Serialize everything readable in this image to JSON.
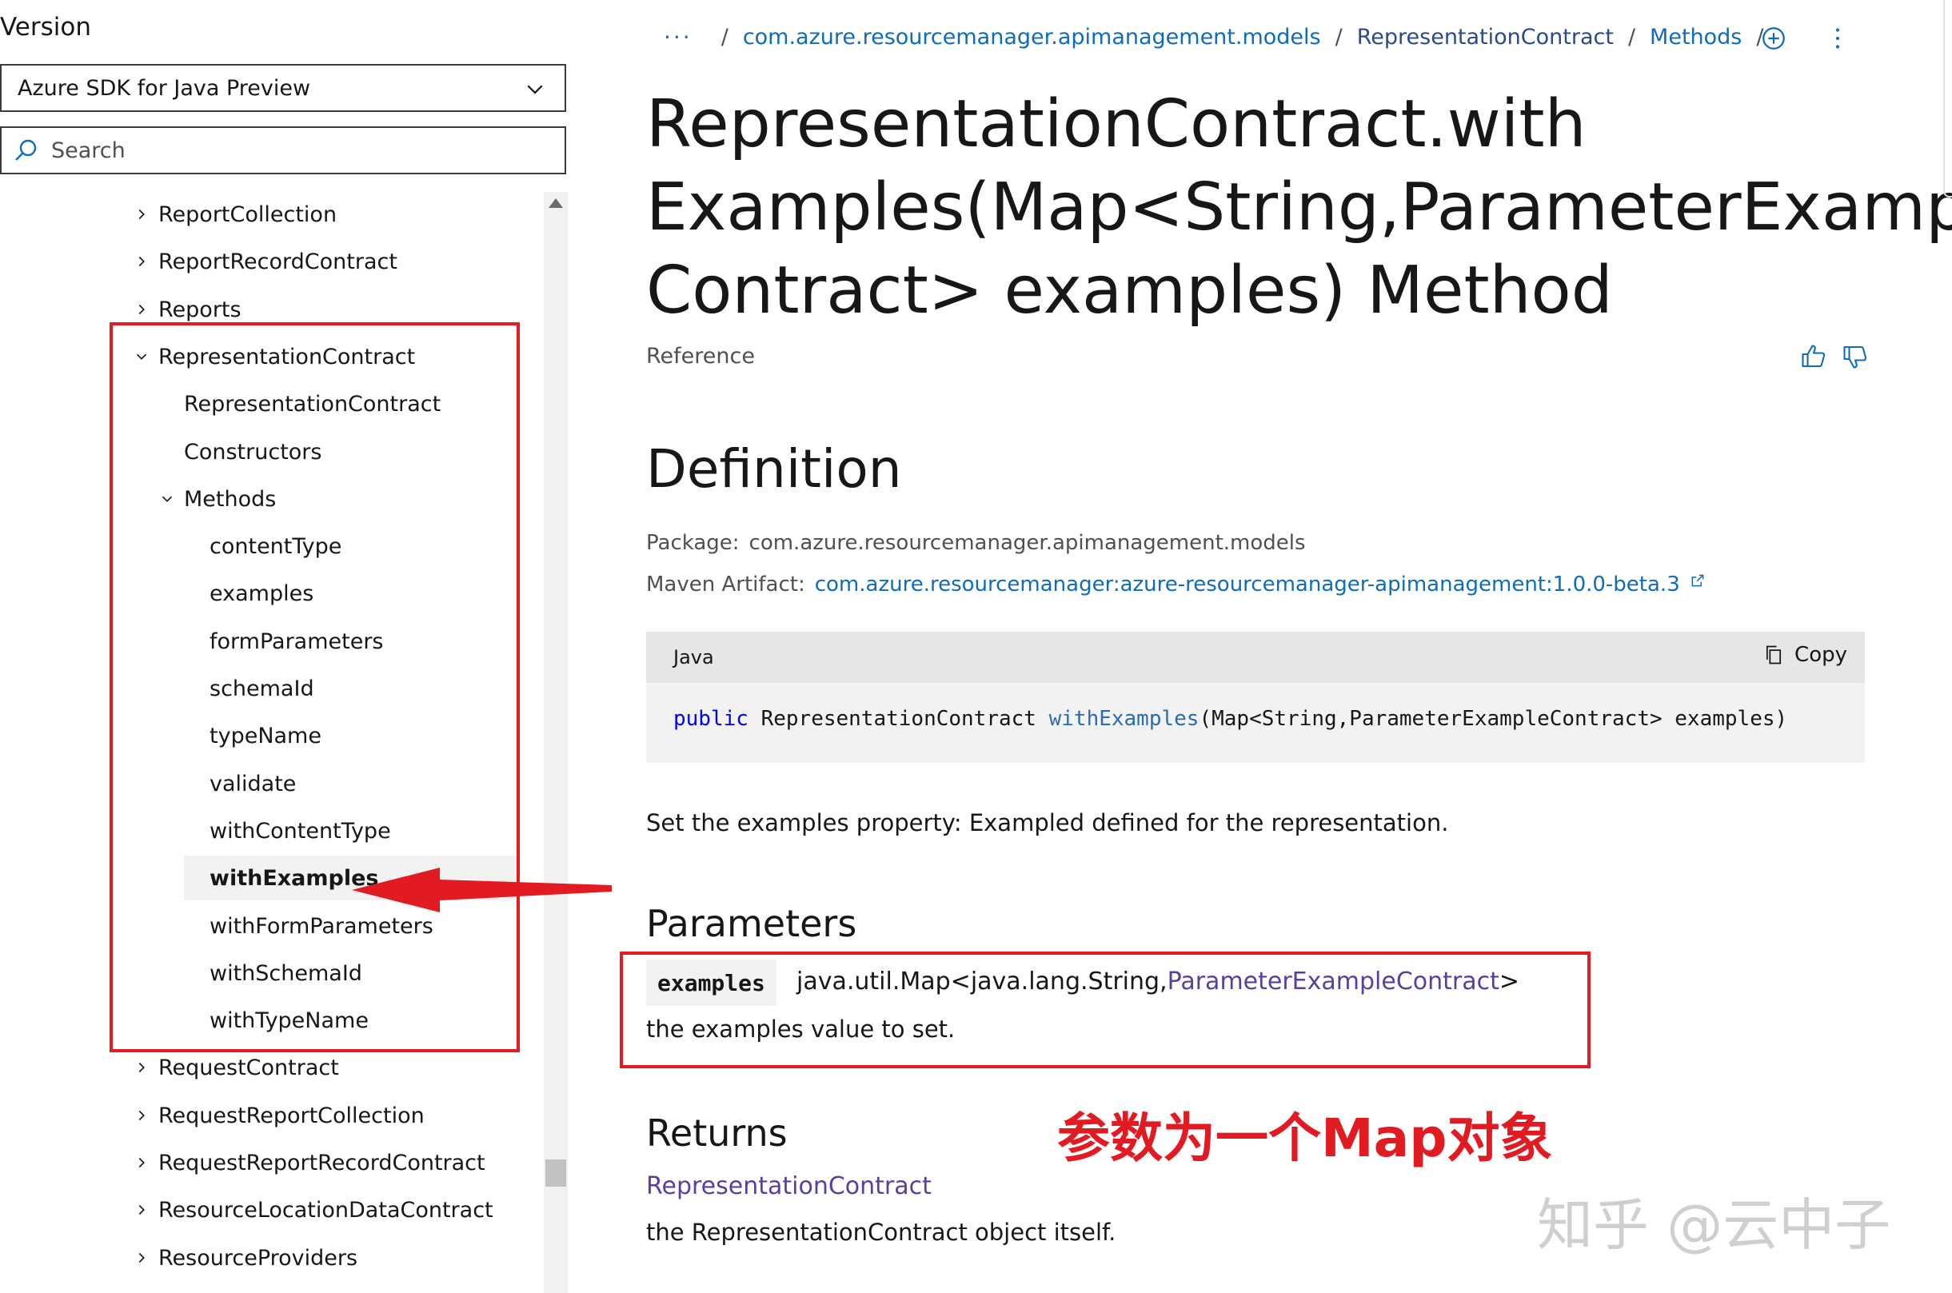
{
  "sidebar": {
    "version_label": "Version",
    "version_value": "Azure SDK for Java Preview",
    "search_placeholder": "Search",
    "toc": [
      {
        "label": "ReportCollection",
        "level": 0,
        "expander": "collapsed"
      },
      {
        "label": "ReportRecordContract",
        "level": 0,
        "expander": "collapsed"
      },
      {
        "label": "Reports",
        "level": 0,
        "expander": "collapsed"
      },
      {
        "label": "RepresentationContract",
        "level": 0,
        "expander": "expanded"
      },
      {
        "label": "RepresentationContract",
        "level": 1,
        "expander": "none"
      },
      {
        "label": "Constructors",
        "level": 1,
        "expander": "none"
      },
      {
        "label": "Methods",
        "level": 1,
        "expander": "expanded"
      },
      {
        "label": "contentType",
        "level": 2,
        "expander": "none"
      },
      {
        "label": "examples",
        "level": 2,
        "expander": "none"
      },
      {
        "label": "formParameters",
        "level": 2,
        "expander": "none"
      },
      {
        "label": "schemaId",
        "level": 2,
        "expander": "none"
      },
      {
        "label": "typeName",
        "level": 2,
        "expander": "none"
      },
      {
        "label": "validate",
        "level": 2,
        "expander": "none"
      },
      {
        "label": "withContentType",
        "level": 2,
        "expander": "none"
      },
      {
        "label": "withExamples",
        "level": 2,
        "expander": "none",
        "selected": true
      },
      {
        "label": "withFormParameters",
        "level": 2,
        "expander": "none"
      },
      {
        "label": "withSchemaId",
        "level": 2,
        "expander": "none"
      },
      {
        "label": "withTypeName",
        "level": 2,
        "expander": "none"
      },
      {
        "label": "RequestContract",
        "level": 0,
        "expander": "collapsed"
      },
      {
        "label": "RequestReportCollection",
        "level": 0,
        "expander": "collapsed"
      },
      {
        "label": "RequestReportRecordContract",
        "level": 0,
        "expander": "collapsed"
      },
      {
        "label": "ResourceLocationDataContract",
        "level": 0,
        "expander": "collapsed"
      },
      {
        "label": "ResourceProviders",
        "level": 0,
        "expander": "collapsed"
      }
    ]
  },
  "breadcrumb": {
    "overflow": "···",
    "items": [
      "com.azure.resourcemanager.apimanagement.models",
      "RepresentationContract",
      "Methods"
    ],
    "trailing_sep": "/"
  },
  "page": {
    "title": "RepresentationContract.with Examples(Map<String,ParameterExample Contract> examples) Method",
    "title_lines": [
      "RepresentationContract.with",
      "Examples(Map<String,ParameterExample",
      "Contract> examples) Method"
    ],
    "reference": "Reference",
    "definition_heading": "Definition",
    "package_label": "Package:",
    "package_value": "com.azure.resourcemanager.apimanagement.models",
    "maven_label": "Maven Artifact:",
    "maven_value": "com.azure.resourcemanager:azure-resourcemanager-apimanagement:1.0.0-beta.3",
    "code": {
      "language": "Java",
      "copy_label": "Copy",
      "keyword": "public",
      "return_type": "RepresentationContract",
      "method": "withExamples",
      "signature_rest": "(Map<String,ParameterExampleContract> examples)"
    },
    "description": "Set the examples property: Exampled defined for the representation.",
    "parameters_heading": "Parameters",
    "param_name": "examples",
    "param_type_prefix": "java.util.Map<java.lang.String,",
    "param_type_link": "ParameterExampleContract",
    "param_type_suffix": ">",
    "param_desc": "the examples value to set.",
    "returns_heading": "Returns",
    "returns_type": "RepresentationContract",
    "returns_desc": "the RepresentationContract object itself."
  },
  "annotation": "参数为一个Map对象",
  "watermark": "知乎 @云中子",
  "icons": {
    "version_chevron": "chevron-down-icon",
    "search": "search-icon",
    "add": "add-circle-icon",
    "more": "more-vertical-icon",
    "thumbs_up": "thumbs-up-icon",
    "thumbs_down": "thumbs-down-icon",
    "copy": "copy-icon",
    "external_link": "external-link-icon"
  },
  "colors": {
    "link": "#0f6cbd",
    "annotation_red": "#e21b23",
    "visited_link": "#5a3f9e"
  }
}
